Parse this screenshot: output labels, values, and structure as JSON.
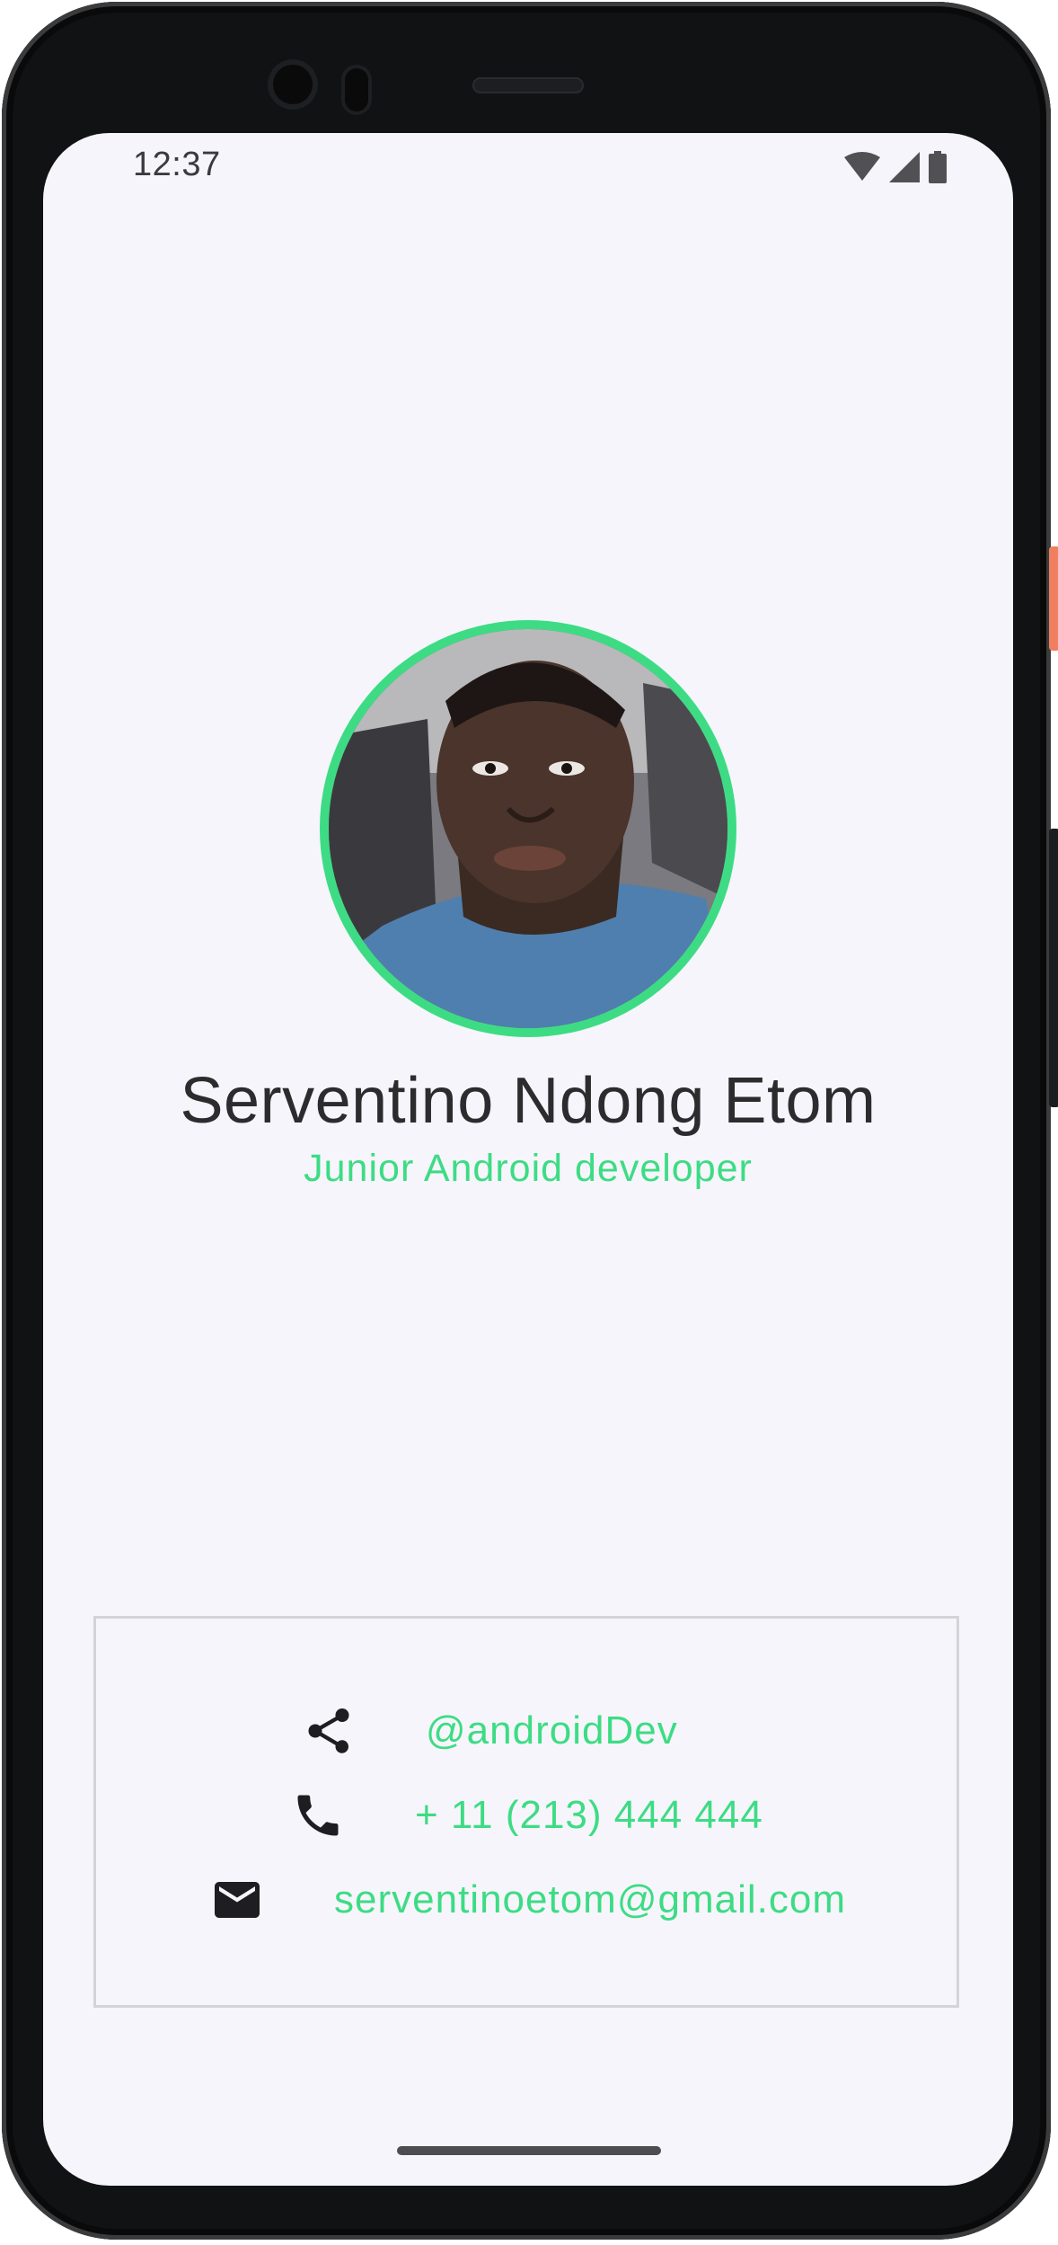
{
  "status_bar": {
    "time": "12:37",
    "icons": [
      "wifi-icon",
      "signal-icon",
      "battery-icon"
    ]
  },
  "profile": {
    "avatar": "profile-photo",
    "name": "Serventino Ndong Etom",
    "title": "Junior Android developer"
  },
  "contacts": [
    {
      "icon": "share-icon",
      "label": "@androidDev"
    },
    {
      "icon": "phone-icon",
      "label": "+ 11 (213) 444 444"
    },
    {
      "icon": "email-icon",
      "label": "serventinoetom@gmail.com"
    }
  ],
  "colors": {
    "accent": "#3ddc84",
    "background": "#f6f5fb",
    "text": "#2c2c2f"
  }
}
